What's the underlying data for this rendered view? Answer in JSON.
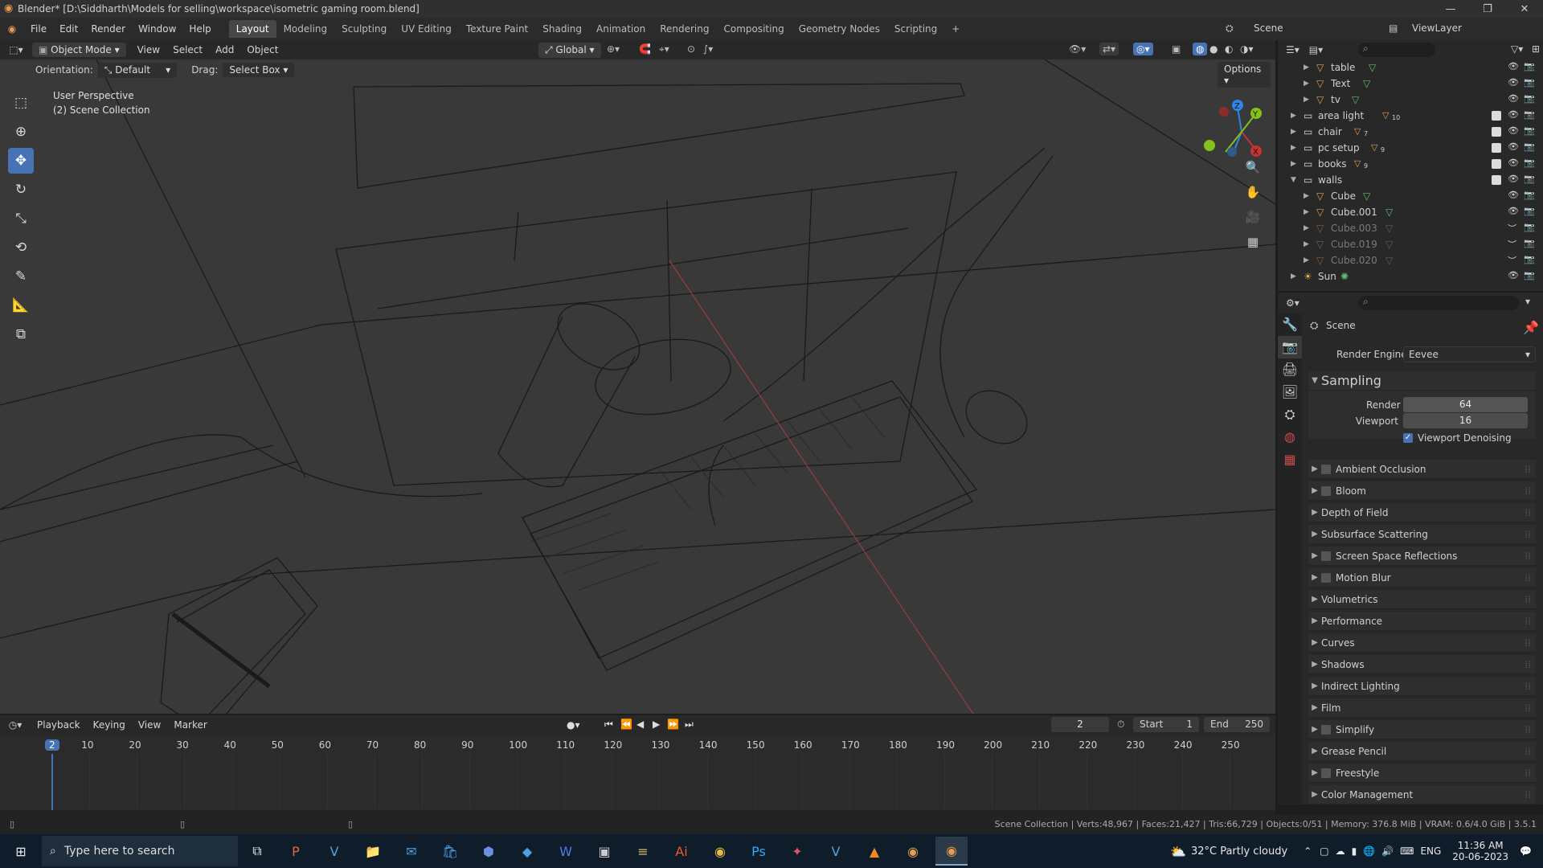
{
  "window": {
    "title": "Blender* [D:\\Siddharth\\Models for selling\\workspace\\isometric gaming room.blend]",
    "controls": [
      "—",
      "❐",
      "✕"
    ]
  },
  "topbar": {
    "menus": [
      "File",
      "Edit",
      "Render",
      "Window",
      "Help"
    ],
    "workspaces": [
      "Layout",
      "Modeling",
      "Sculpting",
      "UV Editing",
      "Texture Paint",
      "Shading",
      "Animation",
      "Rendering",
      "Compositing",
      "Geometry Nodes",
      "Scripting"
    ],
    "add_tab": "+",
    "scene": "Scene",
    "view_layer": "ViewLayer"
  },
  "viewport_header": {
    "mode": "Object Mode",
    "menus": [
      "View",
      "Select",
      "Add",
      "Object"
    ],
    "transform": "Global",
    "orientation_label": "Orientation:",
    "orientation_value": "Default",
    "drag_label": "Drag:",
    "drag_value": "Select Box",
    "options": "Options"
  },
  "viewport": {
    "perspective": "User Perspective",
    "collection": "(2) Scene Collection",
    "gizmo": {
      "x": "X",
      "y": "Y",
      "z": "Z"
    }
  },
  "tools": [
    "select-box",
    "cursor",
    "move",
    "rotate",
    "scale",
    "transform",
    "annotate",
    "measure",
    "add-cube"
  ],
  "outliner": {
    "rows": [
      {
        "name": "table",
        "indent": 2,
        "icon": "mesh-icon",
        "visible": true,
        "dim": false,
        "checkbox": false
      },
      {
        "name": "Text",
        "indent": 2,
        "icon": "mesh-icon",
        "visible": true,
        "dim": false,
        "checkbox": false
      },
      {
        "name": "tv",
        "indent": 2,
        "icon": "mesh-icon",
        "visible": true,
        "dim": false,
        "checkbox": false
      },
      {
        "name": "area light",
        "indent": 1,
        "icon": "collection-icon",
        "badge": "10",
        "visible": true,
        "dim": false,
        "checkbox": true
      },
      {
        "name": "chair",
        "indent": 1,
        "icon": "collection-icon",
        "badge": "7",
        "visible": true,
        "dim": false,
        "checkbox": true
      },
      {
        "name": "pc setup",
        "indent": 1,
        "icon": "collection-icon",
        "badge": "9",
        "visible": true,
        "dim": false,
        "checkbox": true
      },
      {
        "name": "books",
        "indent": 1,
        "icon": "collection-icon",
        "badge": "9",
        "visible": true,
        "dim": false,
        "checkbox": true
      },
      {
        "name": "walls",
        "indent": 1,
        "icon": "collection-icon",
        "visible": true,
        "dim": false,
        "checkbox": true
      },
      {
        "name": "Cube",
        "indent": 2,
        "icon": "mesh-icon",
        "visible": true,
        "dim": false,
        "checkbox": false
      },
      {
        "name": "Cube.001",
        "indent": 2,
        "icon": "mesh-icon",
        "visible": true,
        "dim": false,
        "checkbox": false
      },
      {
        "name": "Cube.003",
        "indent": 2,
        "icon": "mesh-icon",
        "visible": false,
        "dim": true,
        "checkbox": false
      },
      {
        "name": "Cube.019",
        "indent": 2,
        "icon": "mesh-icon",
        "visible": false,
        "dim": true,
        "checkbox": false
      },
      {
        "name": "Cube.020",
        "indent": 2,
        "icon": "mesh-icon",
        "visible": false,
        "dim": true,
        "checkbox": false
      },
      {
        "name": "Sun",
        "indent": 1,
        "icon": "light-icon",
        "visible": true,
        "dim": false,
        "checkbox": false
      }
    ]
  },
  "properties": {
    "context": "Scene",
    "render_engine_label": "Render Engine",
    "render_engine": "Eevee",
    "sampling": {
      "title": "Sampling",
      "render_label": "Render",
      "render_value": "64",
      "viewport_label": "Viewport",
      "viewport_value": "16",
      "denoise_label": "Viewport Denoising"
    },
    "sections": [
      {
        "name": "Ambient Occlusion",
        "checkbox": true
      },
      {
        "name": "Bloom",
        "checkbox": true
      },
      {
        "name": "Depth of Field",
        "checkbox": false
      },
      {
        "name": "Subsurface Scattering",
        "checkbox": false
      },
      {
        "name": "Screen Space Reflections",
        "checkbox": true
      },
      {
        "name": "Motion Blur",
        "checkbox": true
      },
      {
        "name": "Volumetrics",
        "checkbox": false
      },
      {
        "name": "Performance",
        "checkbox": false
      },
      {
        "name": "Curves",
        "checkbox": false
      },
      {
        "name": "Shadows",
        "checkbox": false
      },
      {
        "name": "Indirect Lighting",
        "checkbox": false
      },
      {
        "name": "Film",
        "checkbox": false
      },
      {
        "name": "Simplify",
        "checkbox": true
      },
      {
        "name": "Grease Pencil",
        "checkbox": false
      },
      {
        "name": "Freestyle",
        "checkbox": true
      },
      {
        "name": "Color Management",
        "checkbox": false
      }
    ]
  },
  "timeline": {
    "menus": [
      "Playback",
      "Keying",
      "View",
      "Marker"
    ],
    "current_frame": "2",
    "start_label": "Start",
    "start": "1",
    "end_label": "End",
    "end": "250",
    "ticks": [
      "2",
      "10",
      "20",
      "30",
      "40",
      "50",
      "60",
      "70",
      "80",
      "90",
      "100",
      "110",
      "120",
      "130",
      "140",
      "150",
      "160",
      "170",
      "180",
      "190",
      "200",
      "210",
      "220",
      "230",
      "240",
      "250"
    ]
  },
  "statusbar": {
    "stats": "Scene Collection | Verts:48,967 | Faces:21,427 | Tris:66,729 | Objects:0/51 | Memory: 376.8 MiB | VRAM: 0.6/4.0 GiB | 3.5.1"
  },
  "taskbar": {
    "search_placeholder": "Type here to search",
    "weather": "32°C  Partly cloudy",
    "language": "ENG",
    "time": "11:36 AM",
    "date": "20-06-2023"
  },
  "colors": {
    "accent": "#4772b3",
    "mesh_orange": "#e59b53",
    "axis_red": "#c83232",
    "axis_green": "#84c11a",
    "axis_blue": "#2e86e6"
  }
}
